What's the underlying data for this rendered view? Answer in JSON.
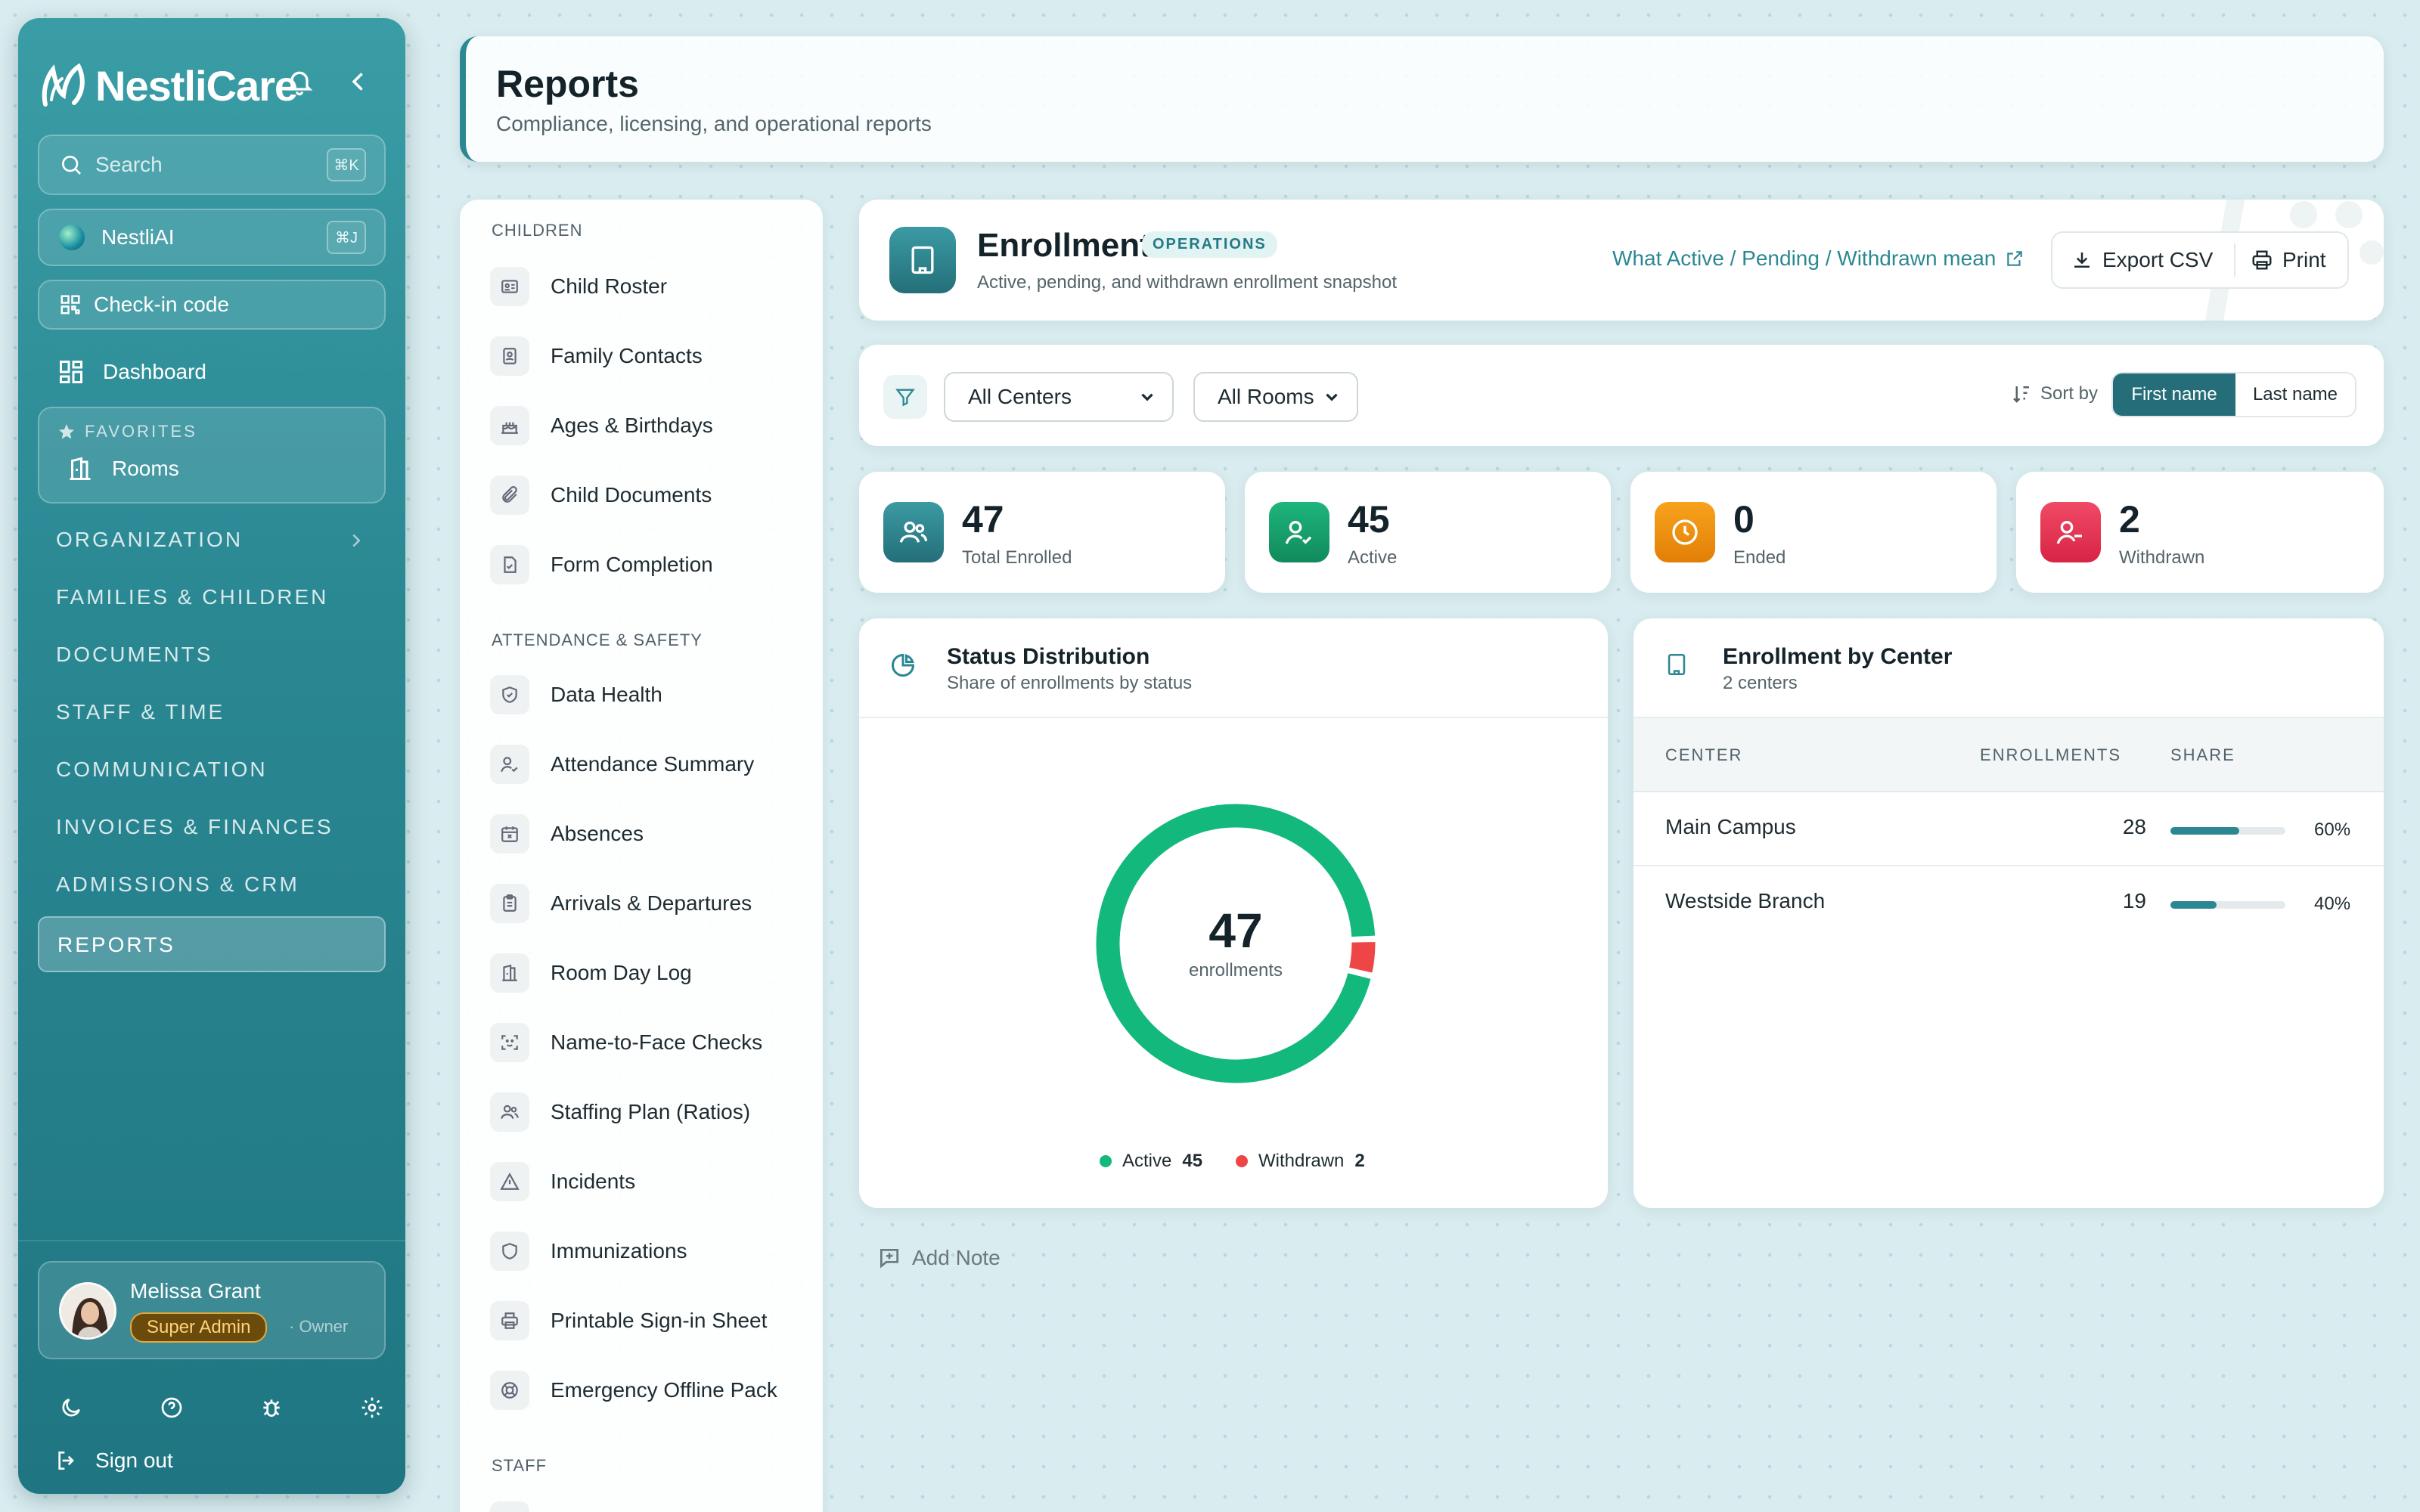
{
  "app": {
    "name": "NestliCare"
  },
  "sidebar": {
    "search": {
      "label": "Search",
      "shortcut": "⌘K"
    },
    "ai": {
      "label": "NestliAI",
      "shortcut": "⌘J"
    },
    "checkin": {
      "label": "Check-in code"
    },
    "dashboard": {
      "label": "Dashboard"
    },
    "favorites": {
      "heading": "FAVORITES",
      "item": "Rooms"
    },
    "sections": [
      "ORGANIZATION",
      "FAMILIES & CHILDREN",
      "DOCUMENTS",
      "STAFF & TIME",
      "COMMUNICATION",
      "INVOICES & FINANCES",
      "ADMISSIONS & CRM",
      "REPORTS"
    ],
    "active_section": "REPORTS",
    "user": {
      "name": "Melissa Grant",
      "role": "Super Admin",
      "suffix": "· Owner"
    },
    "signout": "Sign out"
  },
  "header": {
    "title": "Reports",
    "subtitle": "Compliance, licensing, and operational reports"
  },
  "report_list": {
    "groups": [
      {
        "heading": "CHILDREN",
        "items": [
          "Child Roster",
          "Family Contacts",
          "Ages & Birthdays",
          "Child Documents",
          "Form Completion"
        ]
      },
      {
        "heading": "ATTENDANCE & SAFETY",
        "items": [
          "Data Health",
          "Attendance Summary",
          "Absences",
          "Arrivals & Departures",
          "Room Day Log",
          "Name-to-Face Checks",
          "Staffing Plan (Ratios)",
          "Incidents",
          "Immunizations",
          "Printable Sign-in Sheet",
          "Emergency Offline Pack"
        ]
      },
      {
        "heading": "STAFF",
        "items": []
      }
    ]
  },
  "report": {
    "title": "Enrollment",
    "badge": "OPERATIONS",
    "subtitle": "Active, pending, and withdrawn enrollment snapshot",
    "help_link": "What Active / Pending / Withdrawn mean",
    "export_label": "Export CSV",
    "print_label": "Print"
  },
  "filters": {
    "center": "All Centers",
    "room": "All Rooms",
    "sort_label": "Sort by",
    "sort_options": [
      "First name",
      "Last name"
    ],
    "sort_selected": "First name"
  },
  "stats": [
    {
      "value": "47",
      "label": "Total Enrolled",
      "color": "#2b8893"
    },
    {
      "value": "45",
      "label": "Active",
      "color": "#16a06a"
    },
    {
      "value": "0",
      "label": "Ended",
      "color": "#f08a0c"
    },
    {
      "value": "2",
      "label": "Withdrawn",
      "color": "#e53553"
    }
  ],
  "status_panel": {
    "title": "Status Distribution",
    "subtitle": "Share of enrollments by status",
    "center_value": "47",
    "center_label": "enrollments",
    "legend": [
      {
        "label": "Active",
        "value": "45",
        "color": "#13b97c"
      },
      {
        "label": "Withdrawn",
        "value": "2",
        "color": "#ee4646"
      }
    ]
  },
  "chart_data": {
    "type": "pie",
    "labels": [
      "Active",
      "Withdrawn"
    ],
    "values": [
      45,
      2
    ],
    "colors": [
      "#13b97c",
      "#ee4646"
    ],
    "total": 47
  },
  "center_panel": {
    "title": "Enrollment by Center",
    "subtitle": "2 centers",
    "columns": [
      "CENTER",
      "ENROLLMENTS",
      "SHARE"
    ],
    "rows": [
      {
        "center": "Main Campus",
        "enrollments": "28",
        "share": "60%",
        "share_value": 0.6
      },
      {
        "center": "Westside Branch",
        "enrollments": "19",
        "share": "40%",
        "share_value": 0.4
      }
    ]
  },
  "add_note": "Add Note"
}
